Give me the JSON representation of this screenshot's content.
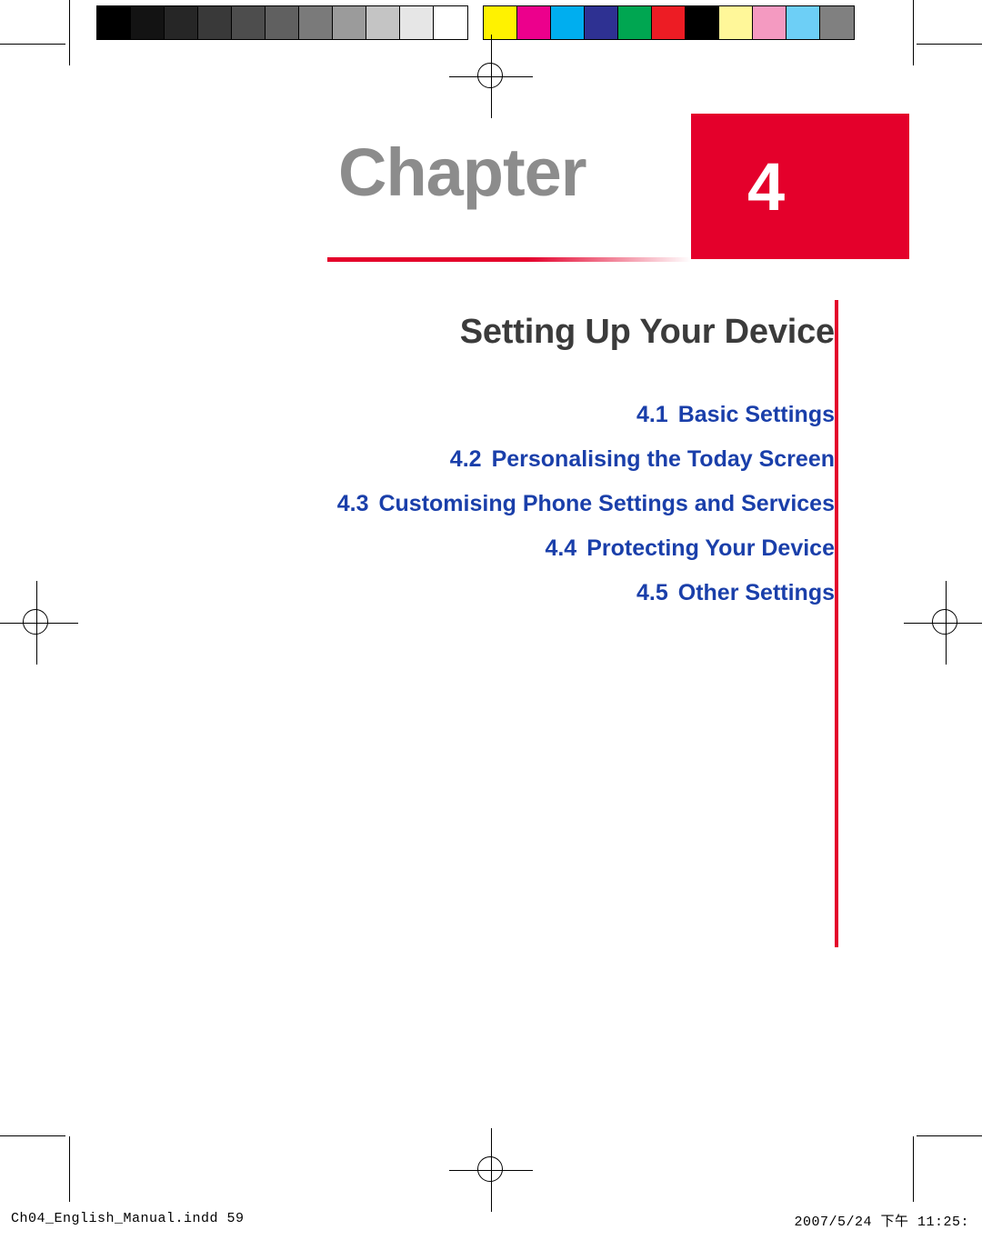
{
  "page": {
    "chapter_word": "Chapter",
    "chapter_number": "4",
    "title": "Setting Up Your Device"
  },
  "toc": [
    {
      "num": "4.1",
      "label": "Basic Settings"
    },
    {
      "num": "4.2",
      "label": "Personalising the Today Screen"
    },
    {
      "num": "4.3",
      "label": "Customising Phone Settings and Services"
    },
    {
      "num": "4.4",
      "label": "Protecting Your Device"
    },
    {
      "num": "4.5",
      "label": "Other Settings"
    }
  ],
  "footer": {
    "left": "Ch04_English_Manual.indd   59",
    "right": "2007/5/24   下午 11:25:"
  },
  "colors": {
    "accent_red": "#e4002b",
    "toc_blue": "#1a3faa",
    "chapter_gray": "#8c8c8c",
    "title_gray": "#3b3b3b"
  },
  "colorbars": {
    "grayscale": [
      "#000000",
      "#131313",
      "#262626",
      "#393939",
      "#4d4d4d",
      "#606060",
      "#7a7a7a",
      "#9b9b9b",
      "#c4c4c4",
      "#e6e6e6",
      "#ffffff"
    ],
    "chroma": [
      "#fff200",
      "#ec008c",
      "#00aeef",
      "#2e3192",
      "#00a651",
      "#ed1c24",
      "#000000",
      "#fff799",
      "#f49ac1",
      "#6dcff6",
      "#808080"
    ]
  }
}
